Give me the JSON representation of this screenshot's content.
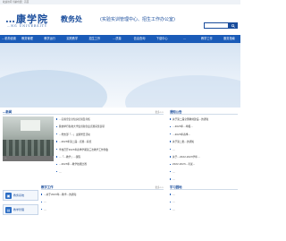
{
  "topbar": {
    "text": "欢迎访问   当前位置：首页"
  },
  "header": {
    "logo": "…康学院",
    "logo_sub": "…NG UNIVERSITY",
    "dept_title": "教务处",
    "dept_sub": "(实验实训管理中心、招生工作办公室)",
    "search_icon": "search-icon"
  },
  "nav": {
    "items": [
      "…机构设置",
      "教务管理",
      "教学运行",
      "实践教学",
      "招生工作",
      "…质量",
      "信息查询",
      "下载中心",
      "…",
      "教学工作",
      "服务指南"
    ]
  },
  "news": {
    "title": "…新闻",
    "more": "更多>>",
    "photo_caption": "…",
    "items": [
      {
        "text": "…实验室安全知识培训及考核",
        "date": ""
      },
      {
        "text": "我校举行各类大学生创新创业竞赛获奖表彰",
        "date": ""
      },
      {
        "text": "…党支部「…」主题党日活动",
        "date": ""
      },
      {
        "text": "…2023年第二届…竞赛…获奖",
        "date": ""
      },
      {
        "text": "学校召开2023年春季学期第三次教学工作例会",
        "date": ""
      },
      {
        "text": "…「…教学」…课程",
        "date": ""
      },
      {
        "text": "…2023年…教学技能比赛",
        "date": ""
      },
      {
        "text": "…",
        "date": ""
      }
    ]
  },
  "notice": {
    "title": "通知公告",
    "more": "",
    "items": [
      {
        "text": "关于第二届全国教材建设…的通知",
        "date": ""
      },
      {
        "text": "…2023年…申报…",
        "date": ""
      },
      {
        "text": "…2023年春季…",
        "date": ""
      },
      {
        "text": "关于第二批…的通知",
        "date": ""
      },
      {
        "text": "…",
        "date": ""
      },
      {
        "text": "关于…2022-2023学年…",
        "date": ""
      },
      {
        "text": "2022-2023…考试…",
        "date": ""
      },
      {
        "text": "…",
        "date": ""
      },
      {
        "text": "…",
        "date": ""
      }
    ]
  },
  "teaching": {
    "title": "教学工作",
    "more": "更多>>",
    "items": [
      {
        "text": "…关于2023年…教学…的通知",
        "date": ""
      },
      {
        "text": "…",
        "date": ""
      },
      {
        "text": "…",
        "date": ""
      }
    ]
  },
  "study": {
    "title": "学习园地",
    "more": "",
    "items": [
      {
        "text": "…",
        "date": ""
      },
      {
        "text": "…",
        "date": ""
      },
      {
        "text": "…",
        "date": ""
      }
    ]
  },
  "side": {
    "items": [
      {
        "label": "教务系统",
        "icon": "system-icon"
      },
      {
        "label": "教学管理",
        "icon": "manage-icon"
      }
    ]
  }
}
